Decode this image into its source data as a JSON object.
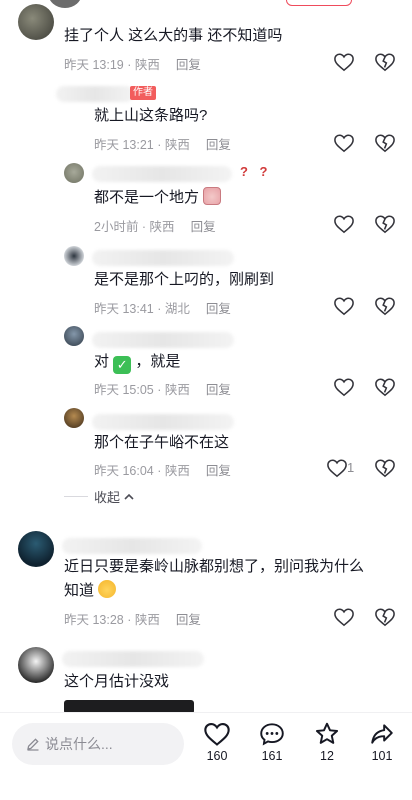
{
  "comments": [
    {
      "text": "挂了个人 这么大的事 还不知道吗",
      "time": "昨天 13:19 · 陕西",
      "reply": "回复"
    },
    {
      "badge": "作者",
      "text": "就上山这条路吗?",
      "time": "昨天 13:21 · 陕西",
      "reply": "回复"
    },
    {
      "qmarks": "? ?",
      "text": "都不是一个地方",
      "time": "2小时前 · 陕西",
      "reply": "回复"
    },
    {
      "text": "是不是那个上叼的，刚刷到",
      "time": "昨天 13:41 · 湖北",
      "reply": "回复"
    },
    {
      "text_before": "对",
      "text_after": "，就是",
      "time": "昨天 15:05 · 陕西",
      "reply": "回复"
    },
    {
      "text": "那个在子午峪不在这",
      "time": "昨天 16:04 · 陕西",
      "reply": "回复",
      "likes": "1"
    },
    {
      "text": "近日只要是秦岭山脉都别想了，别问我为什么知道",
      "time": "昨天 13:28 · 陕西",
      "reply": "回复"
    },
    {
      "text": "这个月估计没戏"
    }
  ],
  "collapse_label": "收起",
  "bottom": {
    "input_placeholder": "说点什么...",
    "like_count": "160",
    "comment_count": "161",
    "fav_count": "12",
    "share_count": "101"
  },
  "icons": [
    "heart-icon",
    "broken-heart-icon",
    "comment-icon",
    "star-icon",
    "share-icon",
    "pencil-icon",
    "chevron-up-icon"
  ],
  "colors": {
    "accent": "#ef4b5c",
    "muted": "#9a9aa0",
    "text": "#161823"
  }
}
